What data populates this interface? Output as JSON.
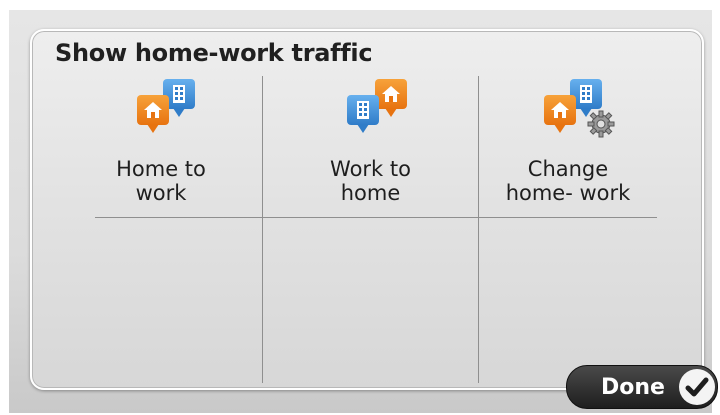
{
  "screen": {
    "title": "Show home-work traffic"
  },
  "tiles": [
    {
      "label": "Home to\nwork",
      "icon": "home-to-work-icon"
    },
    {
      "label": "Work to\nhome",
      "icon": "work-to-home-icon"
    },
    {
      "label": "Change\nhome- work",
      "icon": "change-home-work-icon"
    }
  ],
  "done_button": {
    "label": "Done",
    "icon": "checkmark-icon"
  },
  "colors": {
    "home_pin": "#e77310",
    "work_pin": "#2f7cc8",
    "done_bg": "#2a2a2a"
  }
}
